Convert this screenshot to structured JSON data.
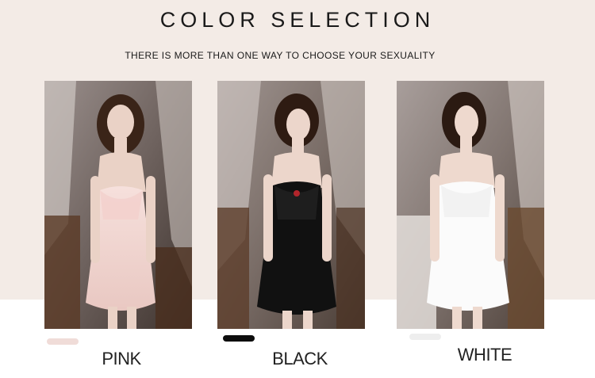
{
  "header": {
    "title": "COLOR SELECTION",
    "subtitle": "THERE IS MORE THAN ONE WAY TO CHOOSE YOUR SEXUALITY"
  },
  "options": [
    {
      "label": "PINK",
      "swatch_color": "#f0dcd8"
    },
    {
      "label": "BLACK",
      "swatch_color": "#0d0d0d"
    },
    {
      "label": "WHITE",
      "swatch_color": "#eeeeee"
    }
  ],
  "colors": {
    "band_background": "#f3ebe6",
    "text": "#1a1a1a"
  }
}
